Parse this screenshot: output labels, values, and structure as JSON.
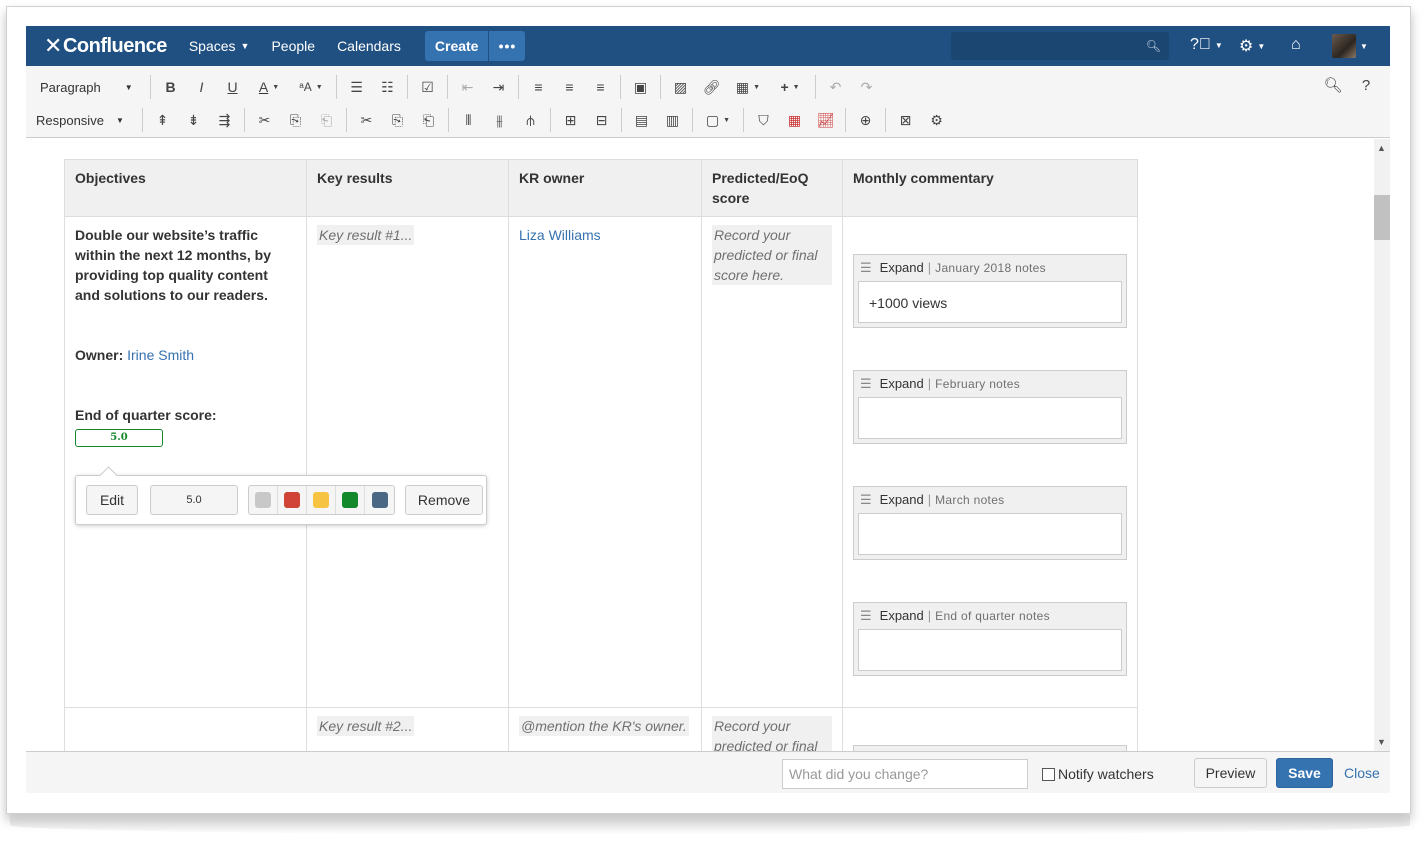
{
  "header": {
    "logo_text": "Confluence",
    "nav": [
      "Spaces",
      "People",
      "Calendars"
    ],
    "create_label": "Create",
    "more_label": "•••",
    "search_placeholder": ""
  },
  "toolbar": {
    "paragraph_label": "Paragraph",
    "responsive_label": "Responsive"
  },
  "table": {
    "headers": [
      "Objectives",
      "Key results",
      "KR owner",
      "Predicted/EoQ score",
      "Monthly commentary"
    ],
    "row1": {
      "objective": "Double our website’s traffic within the next 12 months, by providing top quality content and solutions to our readers.",
      "owner_label": "Owner:",
      "owner_name": "Irine Smith",
      "score_label": "End of quarter score:",
      "score_value": "5.0",
      "key_result": "Key result #1...",
      "kr_owner": "Liza Williams",
      "predicted_placeholder": "Record your predicted or final score here.",
      "expands": [
        {
          "title": "Expand",
          "note": "January 2018 notes",
          "body": "+1000 views"
        },
        {
          "title": "Expand",
          "note": "February notes",
          "body": ""
        },
        {
          "title": "Expand",
          "note": "March notes",
          "body": ""
        },
        {
          "title": "Expand",
          "note": "End of quarter notes",
          "body": ""
        }
      ]
    },
    "row2": {
      "key_result": "Key result #2...",
      "kr_owner": "@mention the KR's owner.",
      "predicted_placeholder": "Record your predicted or final"
    }
  },
  "score_popup": {
    "edit_label": "Edit",
    "value": "5.0",
    "colors": [
      "#c8c8c8",
      "#d04437",
      "#f6c342",
      "#14892c",
      "#4a6785"
    ],
    "remove_label": "Remove"
  },
  "footer": {
    "message_placeholder": "What did you change?",
    "notify_label": "Notify watchers",
    "preview_label": "Preview",
    "save_label": "Save",
    "close_label": "Close"
  }
}
